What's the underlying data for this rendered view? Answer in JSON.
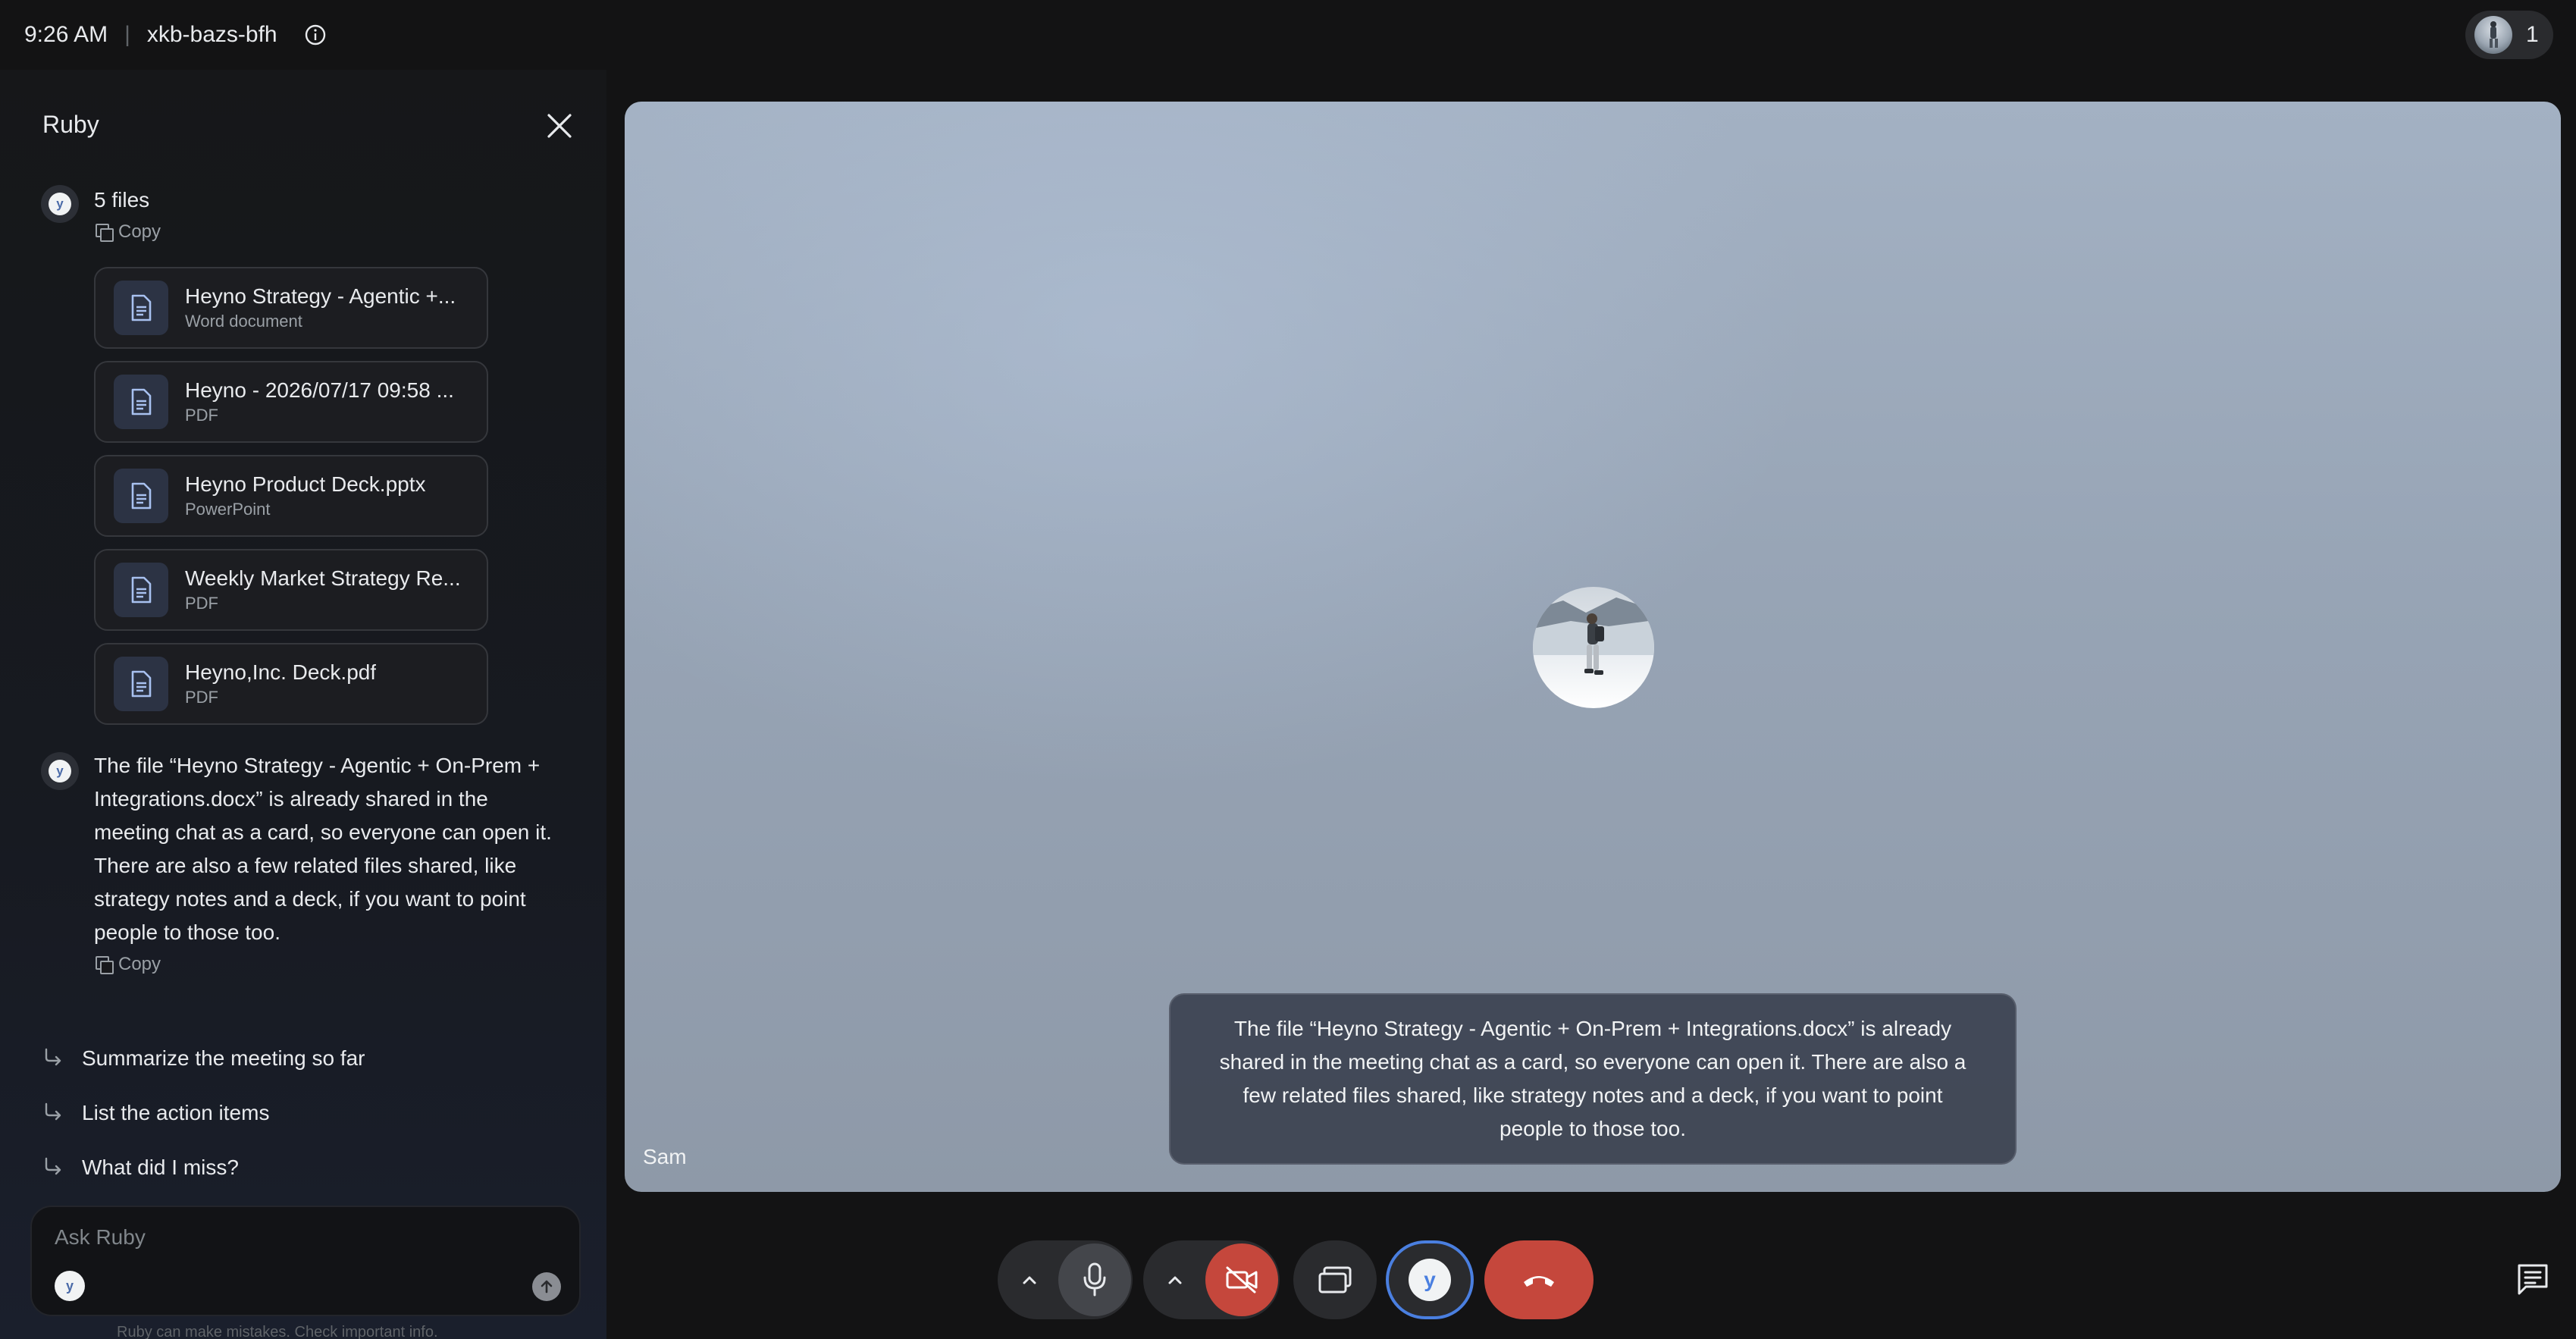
{
  "topbar": {
    "time": "9:26 AM",
    "separator": "|",
    "meeting_code": "xkb-bazs-bfh",
    "info_icon": "info-icon",
    "participant_count": "1"
  },
  "panel": {
    "title": "Ruby",
    "bot_letter": "y",
    "first_message": "5 files",
    "copy_label": "Copy",
    "files": [
      {
        "name": "Heyno Strategy - Agentic +...",
        "type": "Word document"
      },
      {
        "name": "Heyno - 2026/07/17 09:58 ...",
        "type": "PDF"
      },
      {
        "name": "Heyno Product Deck.pptx",
        "type": "PowerPoint"
      },
      {
        "name": "Weekly Market Strategy Re...",
        "type": "PDF"
      },
      {
        "name": "Heyno,Inc. Deck.pdf",
        "type": "PDF"
      }
    ],
    "answer_lines": [
      "The file “Heyno Strategy - Agentic + On-Prem +",
      "Integrations.docx” is already shared in the",
      "meeting chat as a card, so everyone can open it.",
      "There are also a few related files shared, like",
      "strategy notes and a deck, if you want to point",
      "people to those too."
    ],
    "suggestions": [
      "Summarize the meeting so far",
      "List the action items",
      "What did I miss?"
    ],
    "ask_placeholder": "Ask Ruby",
    "disclaimer": "Ruby can make mistakes. Check important info."
  },
  "video": {
    "participant_name": "Sam",
    "caption_lines": [
      "The file “Heyno Strategy - Agentic + On-Prem + Integrations.docx” is already",
      "shared in the meeting chat as a card, so everyone can open it. There are also a",
      "few related files shared, like strategy notes and a deck, if you want to point",
      "people to those too."
    ]
  },
  "controls": {
    "items": [
      "audio-options-chevron",
      "microphone-button",
      "video-options-chevron",
      "camera-off-button",
      "present-screen-button",
      "ruby-assistant-button",
      "leave-call-button"
    ],
    "chat_icon": "chat-icon"
  },
  "colors": {
    "background": "#131314",
    "danger": "#c5473c",
    "accent": "#4a7fe0"
  }
}
